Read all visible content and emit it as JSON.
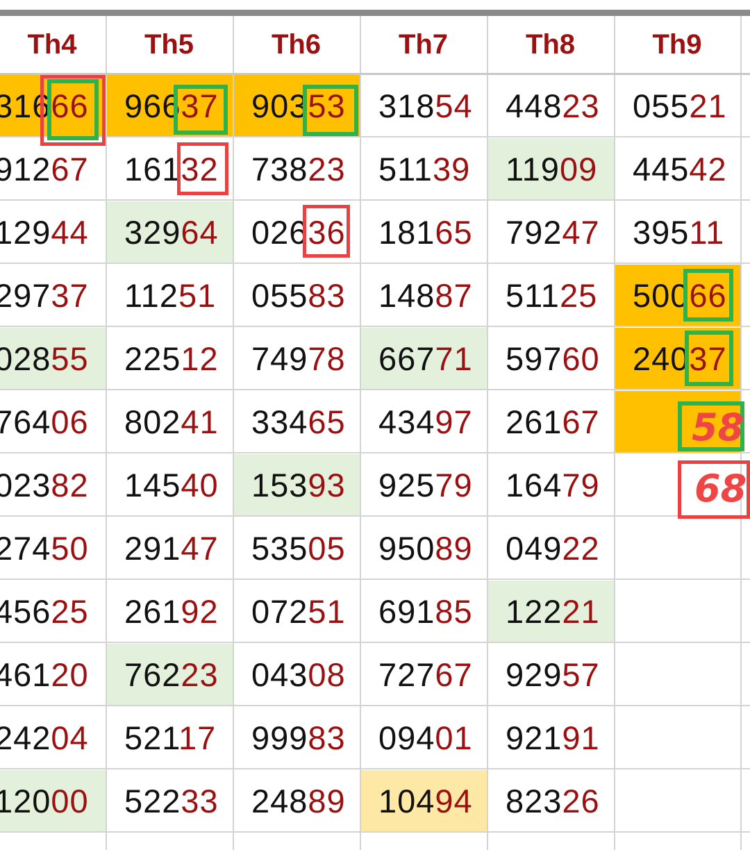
{
  "table": {
    "headers": [
      "Th4",
      "Th5",
      "Th6",
      "Th7",
      "Th8",
      "Th9"
    ],
    "rows": [
      [
        {
          "lead": "316",
          "tail": "66"
        },
        {
          "lead": "966",
          "tail": "37"
        },
        {
          "lead": "903",
          "tail": "53"
        },
        {
          "lead": "318",
          "tail": "54"
        },
        {
          "lead": "448",
          "tail": "23"
        },
        {
          "lead": "055",
          "tail": "21"
        }
      ],
      [
        {
          "lead": "912",
          "tail": "67"
        },
        {
          "lead": "161",
          "tail": "32"
        },
        {
          "lead": "738",
          "tail": "23"
        },
        {
          "lead": "511",
          "tail": "39"
        },
        {
          "lead": "119",
          "tail": "09"
        },
        {
          "lead": "445",
          "tail": "42"
        }
      ],
      [
        {
          "lead": "129",
          "tail": "44"
        },
        {
          "lead": "329",
          "tail": "64"
        },
        {
          "lead": "026",
          "tail": "36"
        },
        {
          "lead": "181",
          "tail": "65"
        },
        {
          "lead": "792",
          "tail": "47"
        },
        {
          "lead": "395",
          "tail": "11"
        }
      ],
      [
        {
          "lead": "297",
          "tail": "37"
        },
        {
          "lead": "112",
          "tail": "51"
        },
        {
          "lead": "055",
          "tail": "83"
        },
        {
          "lead": "148",
          "tail": "87"
        },
        {
          "lead": "511",
          "tail": "25"
        },
        {
          "lead": "500",
          "tail": "66"
        }
      ],
      [
        {
          "lead": "028",
          "tail": "55"
        },
        {
          "lead": "225",
          "tail": "12"
        },
        {
          "lead": "749",
          "tail": "78"
        },
        {
          "lead": "667",
          "tail": "71"
        },
        {
          "lead": "597",
          "tail": "60"
        },
        {
          "lead": "240",
          "tail": "37"
        }
      ],
      [
        {
          "lead": "764",
          "tail": "06"
        },
        {
          "lead": "802",
          "tail": "41"
        },
        {
          "lead": "334",
          "tail": "65"
        },
        {
          "lead": "434",
          "tail": "97"
        },
        {
          "lead": "261",
          "tail": "67"
        },
        {
          "lead": "",
          "tail": ""
        }
      ],
      [
        {
          "lead": "023",
          "tail": "82"
        },
        {
          "lead": "145",
          "tail": "40"
        },
        {
          "lead": "153",
          "tail": "93"
        },
        {
          "lead": "925",
          "tail": "79"
        },
        {
          "lead": "164",
          "tail": "79"
        },
        {
          "lead": "",
          "tail": ""
        }
      ],
      [
        {
          "lead": "274",
          "tail": "50"
        },
        {
          "lead": "291",
          "tail": "47"
        },
        {
          "lead": "535",
          "tail": "05"
        },
        {
          "lead": "950",
          "tail": "89"
        },
        {
          "lead": "049",
          "tail": "22"
        },
        {
          "lead": "",
          "tail": ""
        }
      ],
      [
        {
          "lead": "456",
          "tail": "25"
        },
        {
          "lead": "261",
          "tail": "92"
        },
        {
          "lead": "072",
          "tail": "51"
        },
        {
          "lead": "691",
          "tail": "85"
        },
        {
          "lead": "122",
          "tail": "21"
        },
        {
          "lead": "",
          "tail": ""
        }
      ],
      [
        {
          "lead": "461",
          "tail": "20"
        },
        {
          "lead": "762",
          "tail": "23"
        },
        {
          "lead": "043",
          "tail": "08"
        },
        {
          "lead": "727",
          "tail": "67"
        },
        {
          "lead": "929",
          "tail": "57"
        },
        {
          "lead": "",
          "tail": ""
        }
      ],
      [
        {
          "lead": "242",
          "tail": "04"
        },
        {
          "lead": "521",
          "tail": "17"
        },
        {
          "lead": "999",
          "tail": "83"
        },
        {
          "lead": "094",
          "tail": "01"
        },
        {
          "lead": "921",
          "tail": "91"
        },
        {
          "lead": "",
          "tail": ""
        }
      ],
      [
        {
          "lead": "120",
          "tail": "00"
        },
        {
          "lead": "522",
          "tail": "33"
        },
        {
          "lead": "248",
          "tail": "89"
        },
        {
          "lead": "104",
          "tail": "94"
        },
        {
          "lead": "823",
          "tail": "26"
        },
        {
          "lead": "",
          "tail": ""
        }
      ]
    ]
  },
  "annotations": {
    "handwritten_1": "58",
    "handwritten_2": "68"
  },
  "colors": {
    "header_text": "#9b1111",
    "tail_digits": "#9b1111",
    "highlight_orange": "#ffc000",
    "highlight_green": "#e3f1dc",
    "highlight_yellow": "#fde8a6",
    "marker_green": "#2fb24a",
    "marker_red": "#ea4242"
  }
}
